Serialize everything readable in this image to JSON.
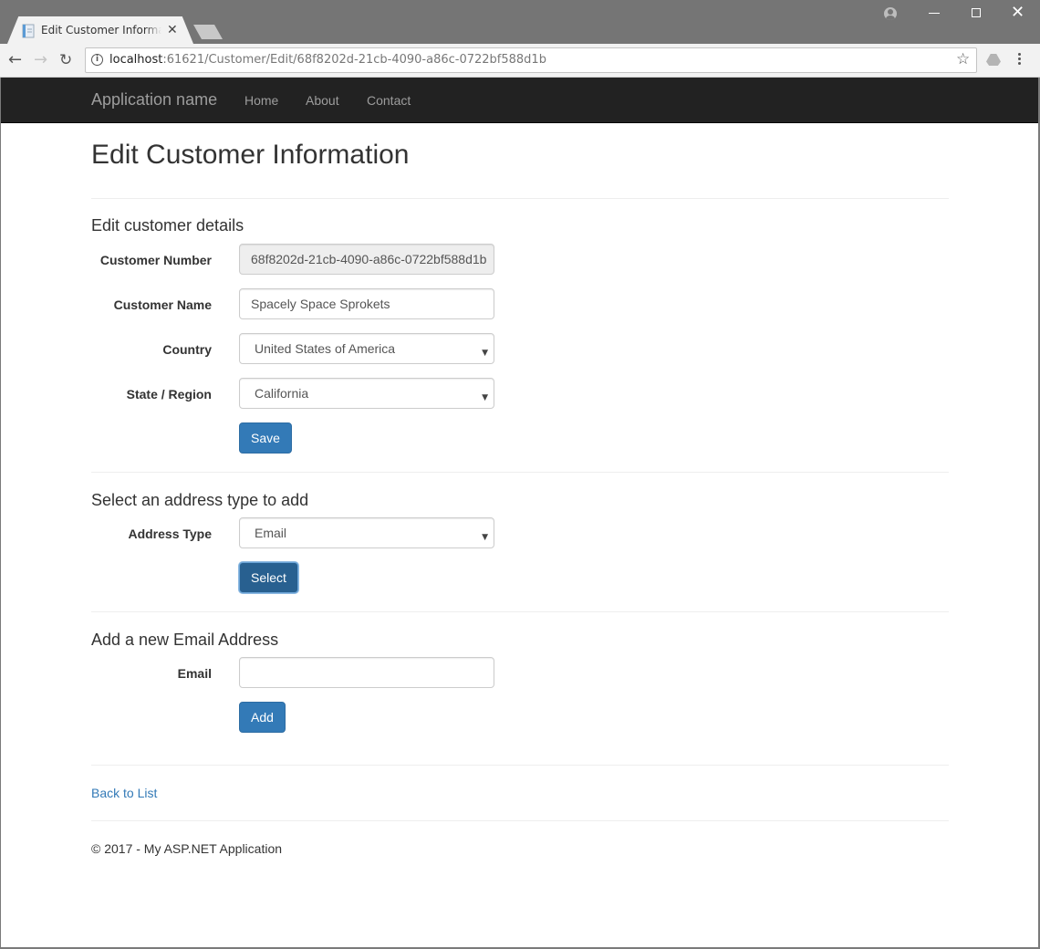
{
  "browser": {
    "tab_title": "Edit Customer Information",
    "url_host": "localhost",
    "url_rest": ":61621/Customer/Edit/68f8202d-21cb-4090-a86c-0722bf588d1b",
    "icons": {
      "tab": "page-icon",
      "close": "close-icon",
      "back": "back-arrow-icon",
      "forward": "forward-arrow-icon",
      "reload": "reload-icon",
      "info": "info-icon",
      "bookmark": "star-icon",
      "extension": "drive-icon",
      "menu": "kebab-menu-icon",
      "profile": "profile-icon",
      "minimize": "minimize-icon",
      "maximize": "maximize-icon",
      "window_close": "close-icon"
    },
    "glyphs": {
      "close": "✕",
      "back": "←",
      "forward": "→",
      "reload": "↻",
      "info": "i",
      "star": "☆",
      "window_close": "✕"
    }
  },
  "navbar": {
    "brand": "Application name",
    "links": [
      {
        "label": "Home"
      },
      {
        "label": "About"
      },
      {
        "label": "Contact"
      }
    ]
  },
  "page": {
    "title": "Edit Customer Information",
    "details_section": {
      "title": "Edit customer details",
      "fields": {
        "customer_number": {
          "label": "Customer Number",
          "value": "68f8202d-21cb-4090-a86c-0722bf588d1b",
          "readonly": true
        },
        "customer_name": {
          "label": "Customer Name",
          "value": "Spacely Space Sprokets"
        },
        "country": {
          "label": "Country",
          "selected": "United States of America"
        },
        "state": {
          "label": "State / Region",
          "selected": "California"
        }
      },
      "save_label": "Save"
    },
    "address_type_section": {
      "title": "Select an address type to add",
      "address_type": {
        "label": "Address Type",
        "selected": "Email"
      },
      "select_label": "Select"
    },
    "email_section": {
      "title": "Add a new Email Address",
      "email": {
        "label": "Email",
        "value": "",
        "placeholder": ""
      },
      "add_label": "Add"
    },
    "back_link": "Back to List",
    "footer": "© 2017 - My ASP.NET Application",
    "caret_glyph": "▼"
  },
  "colors": {
    "navbar_bg": "#222222",
    "primary": "#337ab7",
    "primary_active": "#286090",
    "link": "#337ab7",
    "text": "#333333"
  }
}
